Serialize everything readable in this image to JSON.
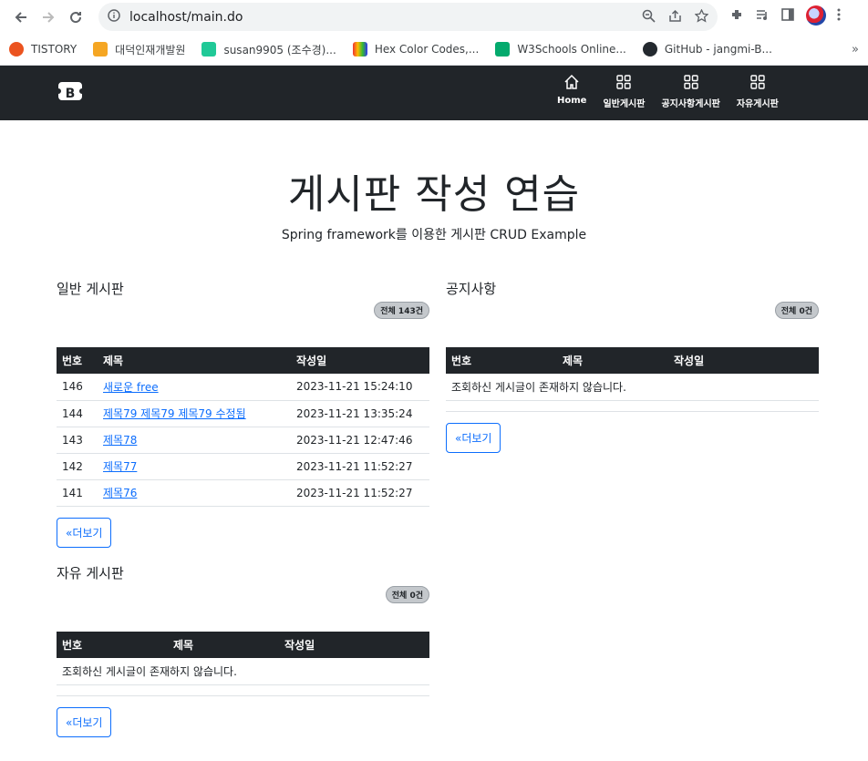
{
  "browser": {
    "url": "localhost/main.do",
    "bookmarks": [
      {
        "label": "TISTORY",
        "color": "#eb531f"
      },
      {
        "label": "대덕인재개발원",
        "color": "#f5a623"
      },
      {
        "label": "susan9905 (조수경)...",
        "color": "#20c997"
      },
      {
        "label": "Hex Color Codes,...",
        "color": "#5b6cff"
      },
      {
        "label": "W3Schools Online...",
        "color": "#04aa6d"
      },
      {
        "label": "GitHub - jangmi-B...",
        "color": "#24292f"
      }
    ]
  },
  "navbar": {
    "brand_letter": "B",
    "links": [
      {
        "label": "Home",
        "icon": "home-icon"
      },
      {
        "label": "일반게시판",
        "icon": "grid-icon"
      },
      {
        "label": "공지사항게시판",
        "icon": "grid-icon"
      },
      {
        "label": "자유게시판",
        "icon": "grid-icon"
      }
    ]
  },
  "hero": {
    "title": "게시판 작성 연습",
    "subtitle": "Spring framework를 이용한 게시판 CRUD Example"
  },
  "boards": {
    "general": {
      "title": "일반 게시판",
      "count": "전체 143건",
      "headers": [
        "번호",
        "제목",
        "작성일"
      ],
      "rows": [
        {
          "no": "146",
          "title": "새로운 free",
          "date": "2023-11-21 15:24:10"
        },
        {
          "no": "144",
          "title": "제목79 제목79 제목79 수정됨",
          "date": "2023-11-21 13:35:24"
        },
        {
          "no": "143",
          "title": "제목78",
          "date": "2023-11-21 12:47:46"
        },
        {
          "no": "142",
          "title": "제목77",
          "date": "2023-11-21 11:52:27"
        },
        {
          "no": "141",
          "title": "제목76",
          "date": "2023-11-21 11:52:27"
        }
      ],
      "more": "«더보기"
    },
    "notice": {
      "title": "공지사항",
      "count": "전체 0건",
      "headers": [
        "번호",
        "제목",
        "작성일"
      ],
      "empty": "조회하신 게시글이 존재하지 않습니다.",
      "more": "«더보기"
    },
    "free": {
      "title": "자유 게시판",
      "count": "전체 0건",
      "headers": [
        "번호",
        "제목",
        "작성일"
      ],
      "empty": "조회하신 게시글이 존재하지 않습니다.",
      "more": "«더보기"
    }
  }
}
